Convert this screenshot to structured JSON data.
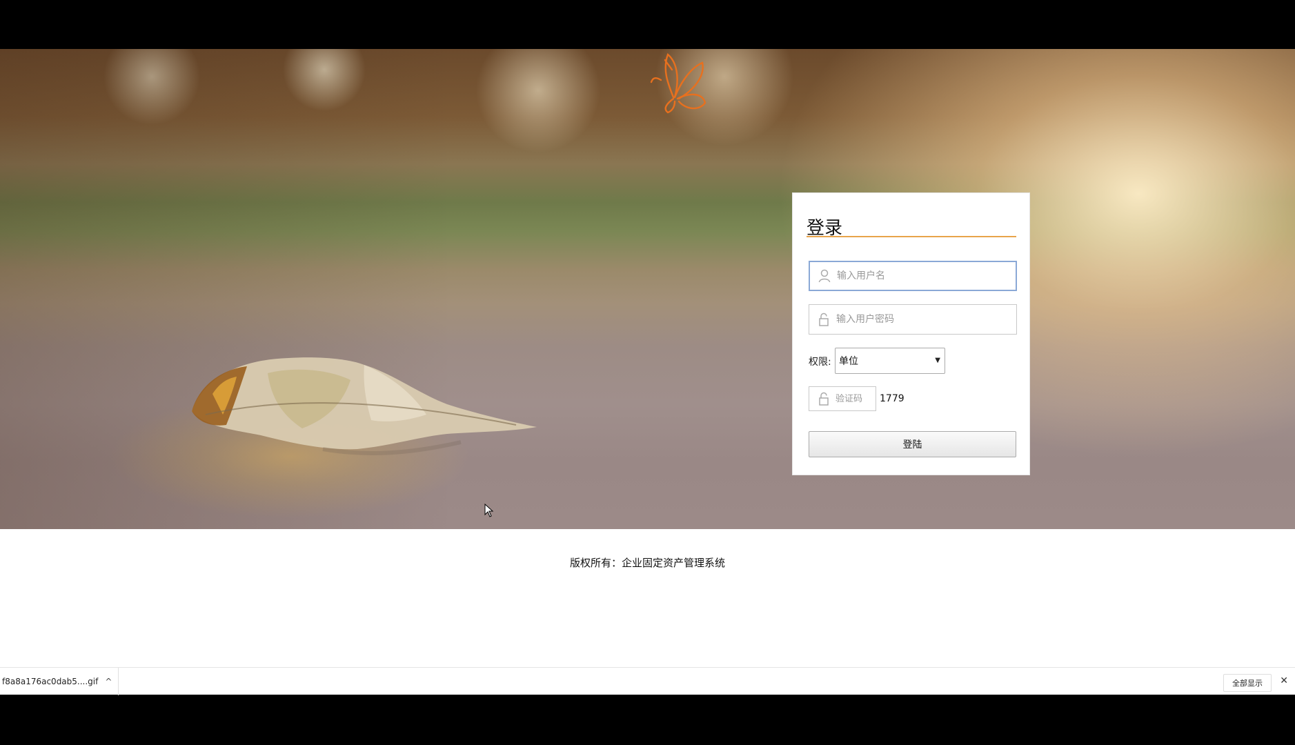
{
  "login": {
    "title": "登录",
    "username_placeholder": "输入用户名",
    "password_placeholder": "输入用户密码",
    "permission_label": "权限:",
    "permission_selected": "单位",
    "captcha_placeholder": "验证码",
    "captcha_code": "1779",
    "submit_label": "登陆"
  },
  "footer": {
    "copyright": "版权所有：企业固定资产管理系统"
  },
  "download_bar": {
    "file_name": "f8a8a176ac0dab5....gif",
    "show_all": "全部显示",
    "close_glyph": "✕",
    "caret_glyph": "^"
  },
  "icons": {
    "user": "user-icon",
    "lock": "lock-icon",
    "butterfly": "butterfly-logo",
    "leaf": "leaf-image"
  },
  "colors": {
    "accent_underline": "#e8a44a",
    "focus_border": "#8aa8d6",
    "butterfly": "#e8701e"
  }
}
